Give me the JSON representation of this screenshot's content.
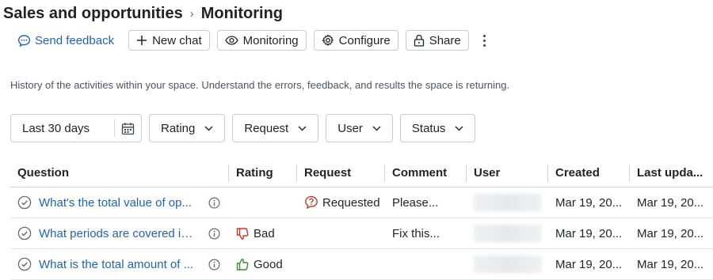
{
  "breadcrumb": {
    "parent": "Sales and opportunities",
    "separator": "›",
    "current": "Monitoring"
  },
  "toolbar": {
    "feedback": "Send feedback",
    "new_chat": "New chat",
    "monitoring": "Monitoring",
    "configure": "Configure",
    "share": "Share"
  },
  "description": "History of the activities within your space. Understand the errors, feedback, and results the space is returning.",
  "filters": {
    "date_range": "Last 30 days",
    "rating": "Rating",
    "request": "Request",
    "user": "User",
    "status": "Status"
  },
  "table": {
    "columns": [
      "Question",
      "Rating",
      "Request",
      "Comment",
      "User",
      "Created",
      "Last upda..."
    ],
    "rows": [
      {
        "question": "What's the total value of op...",
        "rating": "",
        "request": "Requested",
        "comment": "Please...",
        "created": "Mar 19, 20...",
        "updated": "Mar 19, 20..."
      },
      {
        "question": "What periods are covered in...",
        "rating": "Bad",
        "request": "",
        "comment": "Fix this...",
        "created": "Mar 19, 20...",
        "updated": "Mar 19, 20..."
      },
      {
        "question": "What is the total amount of ...",
        "rating": "Good",
        "request": "",
        "comment": "",
        "created": "Mar 19, 20...",
        "updated": "Mar 19, 20..."
      }
    ]
  },
  "colors": {
    "link": "#2264b4",
    "bad": "#c0392b",
    "good": "#3d8b37",
    "requested": "#c0392b"
  }
}
